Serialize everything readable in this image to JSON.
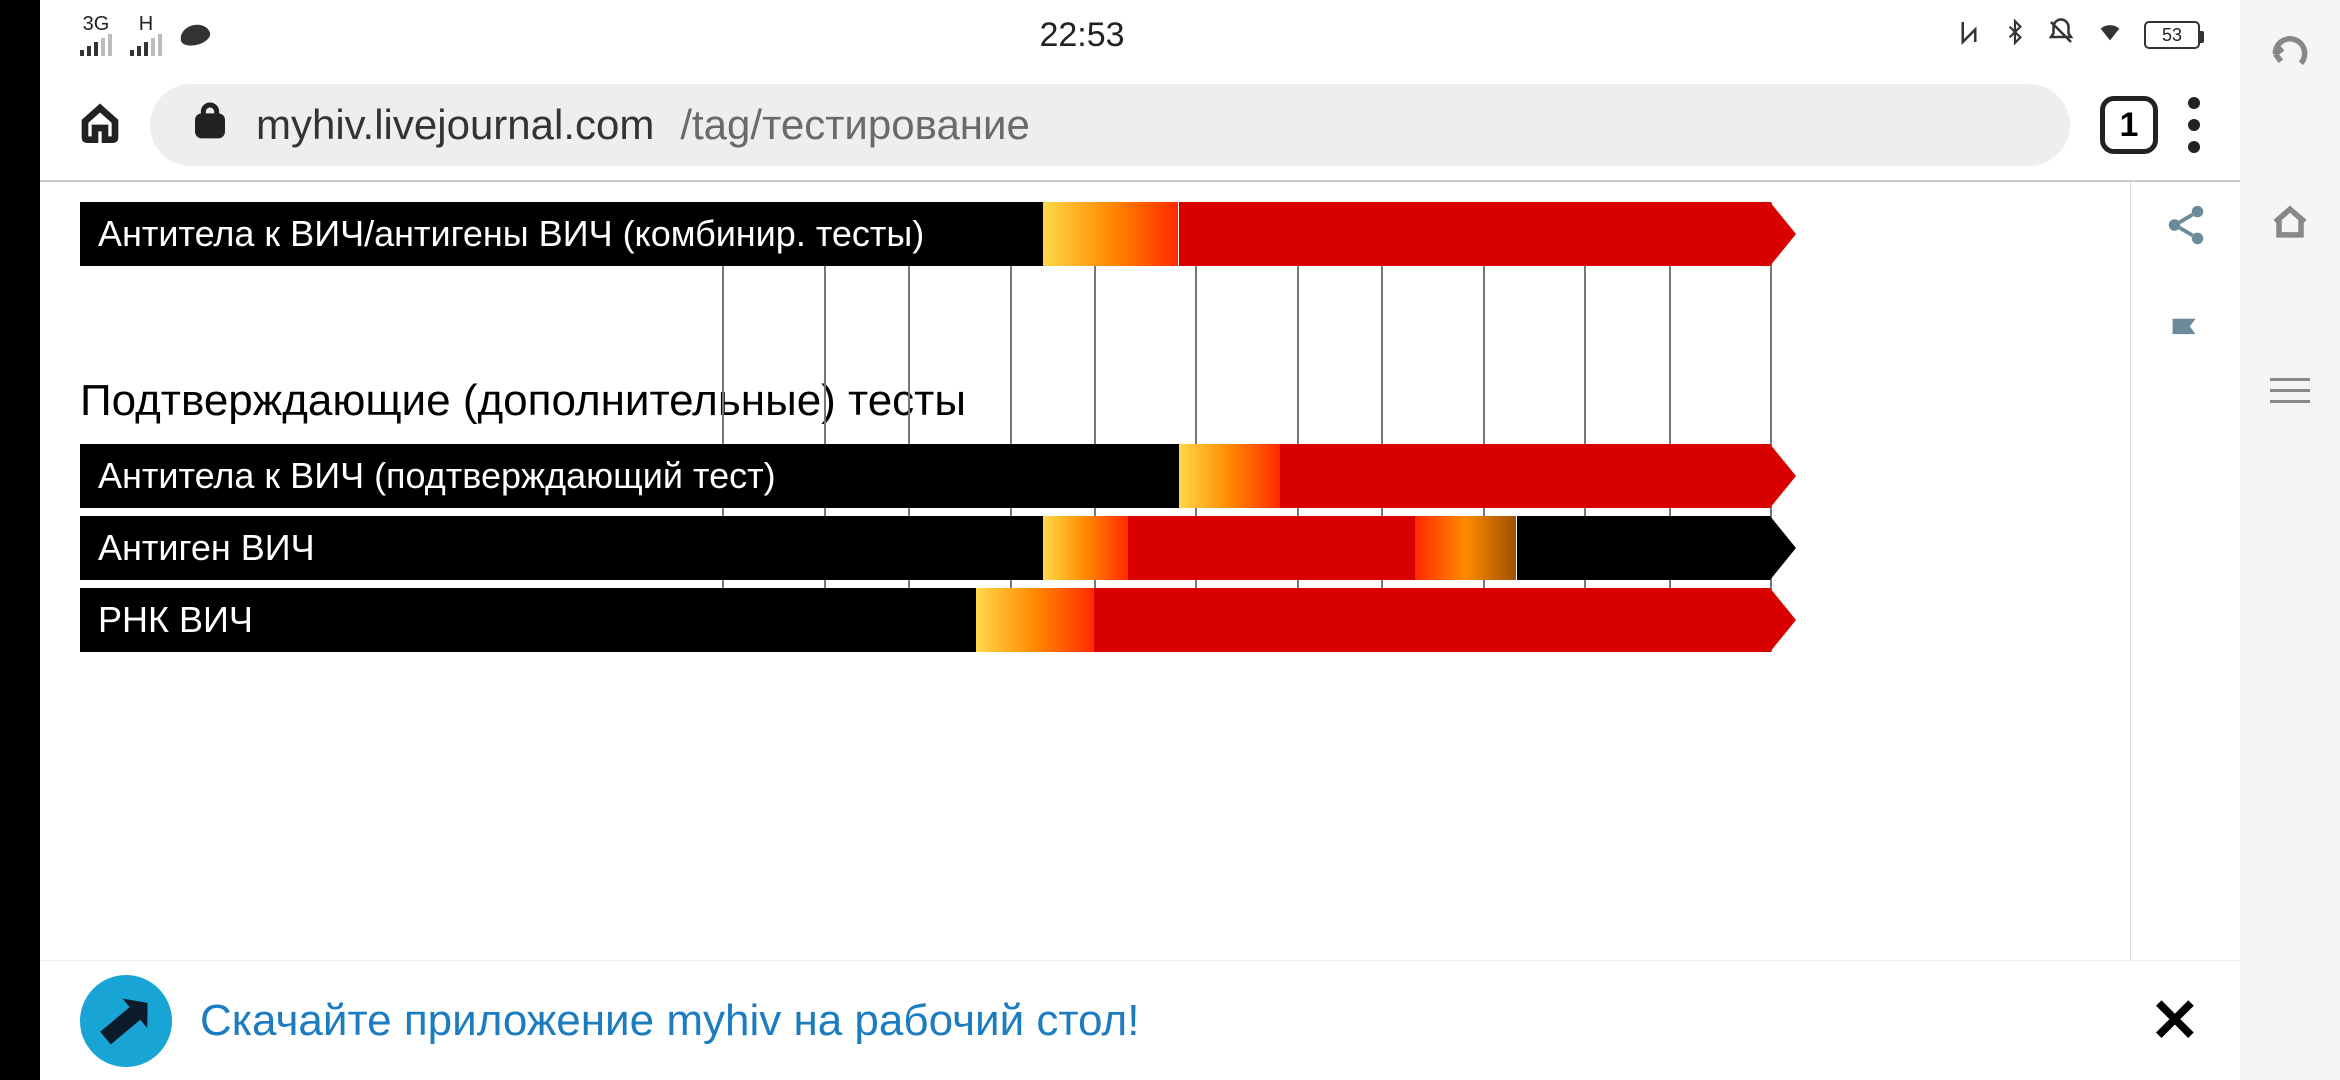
{
  "status": {
    "net1": "3G",
    "net2": "H",
    "clock": "22:53",
    "battery": "53"
  },
  "browser": {
    "host": "myhiv.livejournal.com",
    "path": "/tag/тестирование",
    "tab_count": "1"
  },
  "chart_data": {
    "type": "bar",
    "xlim": [
      0,
      100
    ],
    "gridlines": [
      38,
      44,
      49,
      55,
      60,
      66,
      72,
      77,
      83,
      89,
      94,
      100
    ],
    "sections": [
      {
        "title": null,
        "rows": [
          {
            "label": "Антитела к ВИЧ/антигены ВИЧ (комбинир. тесты)",
            "label_end": 57,
            "segments": [
              {
                "from": 57,
                "to": 65,
                "fill": "gradient"
              },
              {
                "from": 65,
                "to": 100,
                "fill": "red"
              }
            ],
            "arrow": "red"
          }
        ]
      },
      {
        "title": "Подтверждающие (дополнительные) тесты",
        "rows": [
          {
            "label": "Антитела к ВИЧ (подтверждающий тест)",
            "label_end": 65,
            "segments": [
              {
                "from": 65,
                "to": 71,
                "fill": "gradient"
              },
              {
                "from": 71,
                "to": 100,
                "fill": "red"
              }
            ],
            "arrow": "red"
          },
          {
            "label": "Антиген ВИЧ",
            "label_end": 57,
            "segments": [
              {
                "from": 57,
                "to": 62,
                "fill": "gradient"
              },
              {
                "from": 62,
                "to": 79,
                "fill": "red"
              },
              {
                "from": 79,
                "to": 85,
                "fill": "gradient-rev"
              },
              {
                "from": 85,
                "to": 100,
                "fill": "black"
              }
            ],
            "arrow": "black"
          },
          {
            "label": "РНК ВИЧ",
            "label_end": 53,
            "segments": [
              {
                "from": 53,
                "to": 60,
                "fill": "gradient"
              },
              {
                "from": 60,
                "to": 100,
                "fill": "red"
              }
            ],
            "arrow": "red"
          }
        ]
      }
    ]
  },
  "banner": {
    "text": "Скачайте приложение myhiv на рабочий стол!"
  }
}
